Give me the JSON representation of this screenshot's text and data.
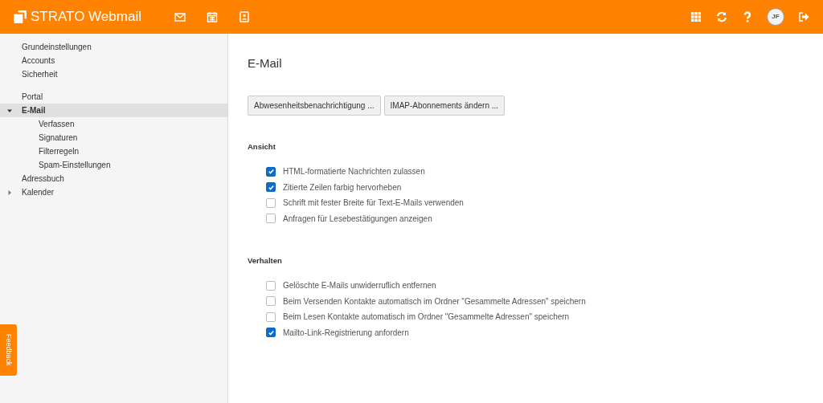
{
  "header": {
    "logo": "**STRATO** Webmail",
    "avatar": "JF"
  },
  "sidebar": {
    "groups": [
      {
        "items": [
          {
            "label": "Grundeinstellungen",
            "selected": false
          },
          {
            "label": "Accounts",
            "selected": false
          },
          {
            "label": "Sicherheit",
            "selected": false
          }
        ]
      },
      {
        "items": [
          {
            "label": "Portal",
            "selected": false
          },
          {
            "label": "E-Mail",
            "selected": true,
            "expanded": true,
            "children": [
              {
                "label": "Verfassen",
                "selected": false
              },
              {
                "label": "Signaturen",
                "selected": false
              },
              {
                "label": "Filterregeln",
                "selected": false
              },
              {
                "label": "Spam-Einstellungen",
                "selected": false
              }
            ]
          },
          {
            "label": "Adressbuch",
            "selected": false
          },
          {
            "label": "Kalender",
            "selected": false,
            "expanded": false
          }
        ]
      }
    ]
  },
  "content": {
    "title": "E-Mail",
    "buttons": [
      "Abwesenheitsbenachrichtigung ...",
      "IMAP-Abonnements ändern ..."
    ],
    "sections": [
      {
        "heading": "Ansicht",
        "options": [
          {
            "label": "HTML-formatierte Nachrichten zulassen",
            "checked": true
          },
          {
            "label": "Zitierte Zeilen farbig hervorheben",
            "checked": true
          },
          {
            "label": "Schrift mit fester Breite für Text-E-Mails verwenden",
            "checked": false
          },
          {
            "label": "Anfragen für Lesebestätigungen anzeigen",
            "checked": false
          }
        ]
      },
      {
        "heading": "Verhalten",
        "options": [
          {
            "label": "Gelöschte E-Mails unwiderruflich entfernen",
            "checked": false
          },
          {
            "label": "Beim Versenden Kontakte automatisch im Ordner \"Gesammelte Adressen\" speichern",
            "checked": false
          },
          {
            "label": "Beim Lesen Kontakte automatisch im Ordner \"Gesammelte Adressen\" speichern",
            "checked": false
          },
          {
            "label": "Mailto-Link-Registrierung anfordern",
            "checked": true
          }
        ]
      }
    ]
  },
  "feedback": "Feedback"
}
